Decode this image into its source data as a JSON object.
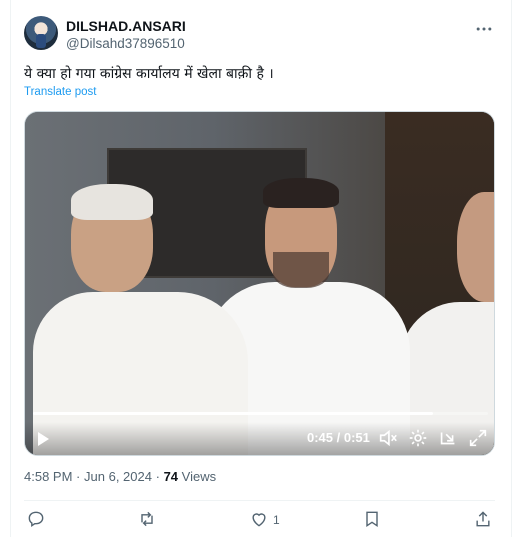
{
  "tweet": {
    "display_name": "DILSHAD.ANSARI",
    "handle": "@Dilsahd37896510",
    "text": "ये क्या हो गया कांग्रेस कार्यालय में खेला बाक़ी है ।",
    "translate_label": "Translate post",
    "more_icon": "more-horizontal-icon"
  },
  "video": {
    "time_display": "0:45 / 0:51",
    "progress_fraction": 0.88,
    "icons": [
      "play-icon",
      "mute-icon",
      "settings-icon",
      "dock-icon",
      "fullscreen-icon"
    ]
  },
  "meta": {
    "time": "4:58 PM",
    "sep1": "·",
    "date": "Jun 6, 2024",
    "sep2": "·",
    "views_count": "74",
    "views_label": "Views"
  },
  "actions": {
    "reply_count": "",
    "repost_count": "",
    "like_count": "1",
    "icons": [
      "reply-icon",
      "repost-icon",
      "like-icon",
      "bookmark-icon",
      "share-icon"
    ]
  },
  "colors": {
    "link": "#1d9bf0",
    "secondary_text": "#536471",
    "primary_text": "#0f1419",
    "border": "#eff3f4"
  }
}
